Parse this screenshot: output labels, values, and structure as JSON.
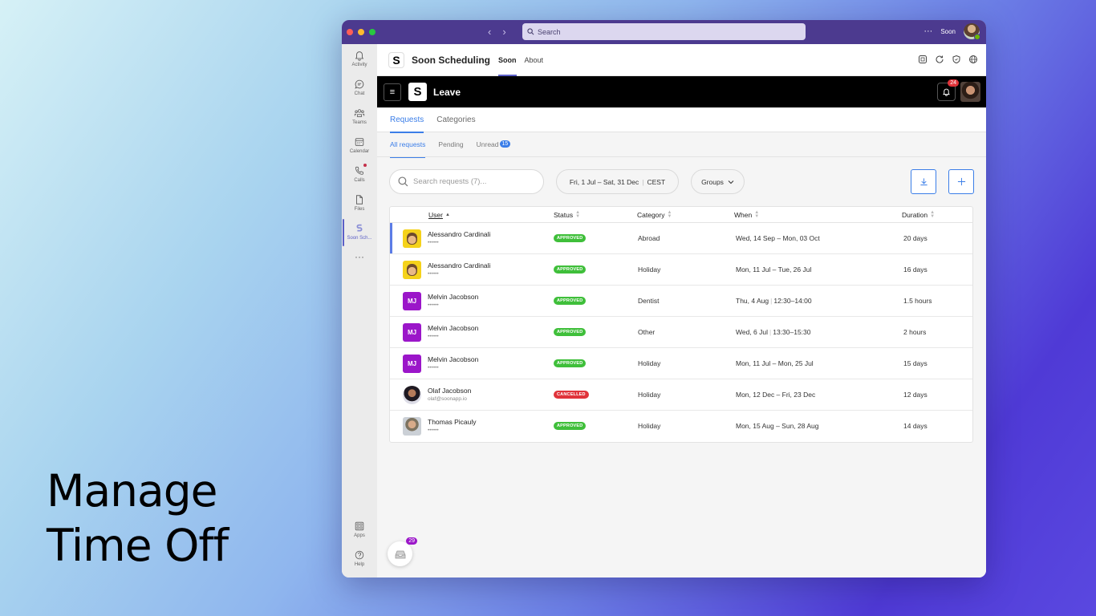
{
  "tagline": {
    "line1": "Manage",
    "line2": "Time Off"
  },
  "titlebar": {
    "search_placeholder": "Search",
    "more": "···",
    "account_name": "Soon"
  },
  "rail": {
    "items": [
      {
        "label": "Activity"
      },
      {
        "label": "Chat"
      },
      {
        "label": "Teams"
      },
      {
        "label": "Calendar"
      },
      {
        "label": "Calls"
      },
      {
        "label": "Files"
      },
      {
        "label": "Soon Sch..."
      }
    ],
    "more": "···",
    "apps": "Apps",
    "help": "Help"
  },
  "app": {
    "logo": "S",
    "title": "Soon Scheduling",
    "tabs": [
      {
        "label": "Soon"
      },
      {
        "label": "About"
      }
    ]
  },
  "leave": {
    "logo": "S",
    "title": "Leave",
    "notifications": "24",
    "menu_icon": "≡"
  },
  "tabs": [
    {
      "label": "Requests"
    },
    {
      "label": "Categories"
    }
  ],
  "subtabs": {
    "all": "All requests",
    "pending": "Pending",
    "unread": "Unread",
    "unread_count": "15"
  },
  "toolbar": {
    "search_placeholder": "Search requests (7)...",
    "date_range": "Fri, 1 Jul – Sat, 31 Dec",
    "timezone": "CEST",
    "groups": "Groups"
  },
  "table": {
    "columns": [
      "User",
      "Status",
      "Category",
      "When",
      "Duration"
    ],
    "rows": [
      {
        "name": "Alessandro Cardinali",
        "sub": "••••••",
        "status": "APPROVED",
        "category": "Abroad",
        "when": "Wed, 14 Sep – Mon, 03 Oct",
        "time": "",
        "duration": "20 days"
      },
      {
        "name": "Alessandro Cardinali",
        "sub": "••••••",
        "status": "APPROVED",
        "category": "Holiday",
        "when": "Mon, 11 Jul – Tue, 26 Jul",
        "time": "",
        "duration": "16 days"
      },
      {
        "name": "Melvin Jacobson",
        "initials": "MJ",
        "sub": "••••••",
        "status": "APPROVED",
        "category": "Dentist",
        "when": "Thu, 4 Aug",
        "time": "12:30–14:00",
        "duration": "1.5 hours"
      },
      {
        "name": "Melvin Jacobson",
        "initials": "MJ",
        "sub": "••••••",
        "status": "APPROVED",
        "category": "Other",
        "when": "Wed, 6 Jul",
        "time": "13:30–15:30",
        "duration": "2 hours"
      },
      {
        "name": "Melvin Jacobson",
        "initials": "MJ",
        "sub": "••••••",
        "status": "APPROVED",
        "category": "Holiday",
        "when": "Mon, 11 Jul – Mon, 25 Jul",
        "time": "",
        "duration": "15 days"
      },
      {
        "name": "Olaf Jacobson",
        "sub": "olaf@soonapp.io",
        "status": "CANCELLED",
        "category": "Holiday",
        "when": "Mon, 12 Dec – Fri, 23 Dec",
        "time": "",
        "duration": "12 days"
      },
      {
        "name": "Thomas Picauly",
        "sub": "••••••",
        "status": "APPROVED",
        "category": "Holiday",
        "when": "Mon, 15 Aug – Sun, 28 Aug",
        "time": "",
        "duration": "14 days"
      }
    ]
  },
  "inbox": {
    "count": "29"
  },
  "colors": {
    "accent": "#3b7ee8",
    "teams_purple": "#4c3a8f",
    "approved": "#3fbf3a",
    "cancelled": "#e0333a",
    "avatar_purple": "#9b16c9"
  }
}
